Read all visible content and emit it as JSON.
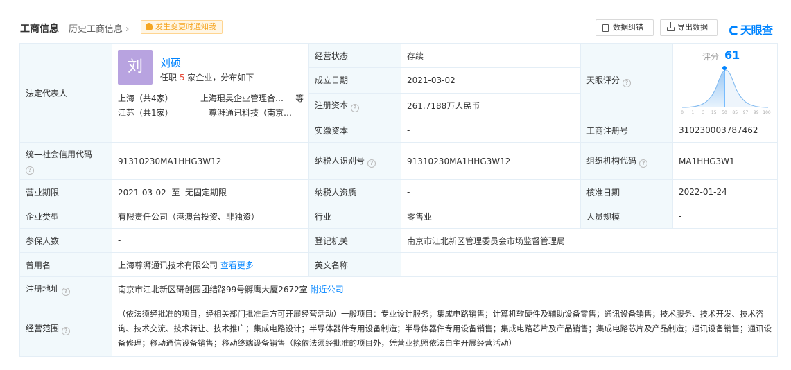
{
  "header": {
    "title": "工商信息",
    "history": "历史工商信息",
    "notify": "发生变更时通知我",
    "btn_report": "数据纠错",
    "btn_export": "导出数据",
    "logo": "天眼查"
  },
  "legal": {
    "label": "法定代表人",
    "avatar_char": "刘",
    "name": "刘硕",
    "sub_prefix": "任职",
    "sub_count": "5",
    "sub_suffix": "家企业，分布如下",
    "regions": [
      {
        "region": "上海（共4家）",
        "company": "上海琨昊企业管理合…"
      },
      {
        "region": "江苏（共1家）",
        "company": "尊湃通讯科技（南京…"
      }
    ],
    "more": "等"
  },
  "rows": {
    "status_label": "经营状态",
    "status_value": "存续",
    "found_label": "成立日期",
    "found_value": "2021-03-02",
    "capital_label": "注册资本",
    "capital_value": "261.7188万人民币",
    "paid_label": "实缴资本",
    "paid_value": "-",
    "score_label": "天眼评分",
    "reg_no_label": "工商注册号",
    "reg_no_value": "310230003787462",
    "credit_label": "统一社会信用代码",
    "credit_value": "91310230MA1HHG3W12",
    "tax_label": "纳税人识别号",
    "tax_value": "91310230MA1HHG3W12",
    "org_label": "组织机构代码",
    "org_value": "MA1HHG3W1",
    "term_label": "营业期限",
    "term_value": "2021-03-02  至  无固定期限",
    "taxq_label": "纳税人资质",
    "taxq_value": "-",
    "approve_label": "核准日期",
    "approve_value": "2022-01-24",
    "type_label": "企业类型",
    "type_value": "有限责任公司（港澳台投资、非独资）",
    "industry_label": "行业",
    "industry_value": "零售业",
    "staff_label": "人员规模",
    "staff_value": "-",
    "insured_label": "参保人数",
    "insured_value": "-",
    "authority_label": "登记机关",
    "authority_value": "南京市江北新区管理委员会市场监督管理局",
    "former_label": "曾用名",
    "former_value": "上海尊湃通讯技术有限公司",
    "former_more": "查看更多",
    "en_label": "英文名称",
    "en_value": "-",
    "addr_label": "注册地址",
    "addr_value": "南京市江北新区研创园团结路99号孵鹰大厦2672室",
    "addr_near": "附近公司",
    "scope_label": "经营范围",
    "scope_value": "（依法须经批准的项目，经相关部门批准后方可开展经营活动）一般项目：专业设计服务；集成电路销售；计算机软硬件及辅助设备零售；通讯设备销售；技术服务、技术开发、技术咨询、技术交流、技术转让、技术推广；集成电路设计；半导体器件专用设备制造；半导体器件专用设备销售；集成电路芯片及产品销售；集成电路芯片及产品制造；通讯设备销售；通讯设备修理；移动通信设备销售；移动终端设备销售（除依法须经批准的项目外，凭营业执照依法自主开展经营活动）"
  },
  "score": {
    "label": "评分",
    "value": "61",
    "ticks": [
      "0",
      "1",
      "3",
      "15",
      "50",
      "85",
      "97",
      "99",
      "100"
    ]
  },
  "colors": {
    "accent": "#0084ff",
    "label_bg": "#f2f9fc",
    "border": "#e4eef6",
    "notify": "#f5a623"
  }
}
